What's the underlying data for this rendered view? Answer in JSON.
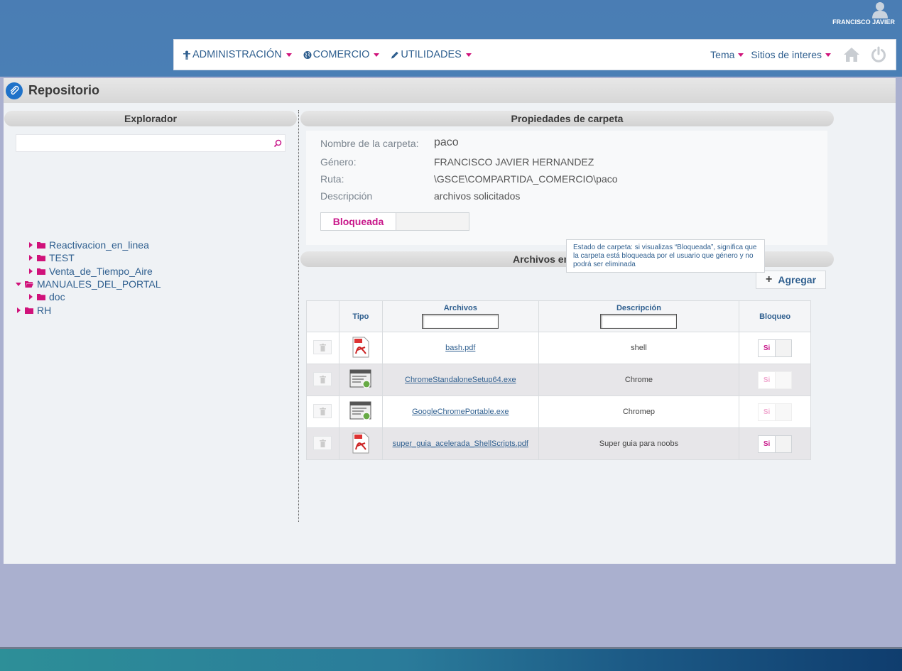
{
  "user": {
    "name": "FRANCISCO JAVIER"
  },
  "nav": {
    "menus": [
      {
        "label": "ADMINISTRACIÓN",
        "icon": "person-icon"
      },
      {
        "label": "COMERCIO",
        "icon": "globe-icon"
      },
      {
        "label": "UTILIDADES",
        "icon": "pencil-icon"
      }
    ],
    "right": [
      {
        "label": "Tema"
      },
      {
        "label": "Sitios de interes"
      }
    ]
  },
  "page": {
    "title": "Repositorio"
  },
  "explorer": {
    "header": "Explorador",
    "search_value": "",
    "tree": [
      {
        "label": "Reactivacion_en_linea",
        "level": 1,
        "expanded": false
      },
      {
        "label": "TEST",
        "level": 1,
        "expanded": false
      },
      {
        "label": "Venta_de_Tiempo_Aire",
        "level": 1,
        "expanded": false
      },
      {
        "label": "MANUALES_DEL_PORTAL",
        "level": 0,
        "expanded": true
      },
      {
        "label": "doc",
        "level": 1,
        "expanded": false
      },
      {
        "label": "RH",
        "level": 0,
        "expanded": false
      }
    ]
  },
  "properties": {
    "header": "Propiedades de carpeta",
    "name_label": "Nombre de la carpeta:",
    "name_value": "paco",
    "genre_label": "Género:",
    "genre_value": "FRANCISCO JAVIER HERNANDEZ",
    "path_label": "Ruta:",
    "path_value": "\\GSCE\\COMPARTIDA_COMERCIO\\paco",
    "desc_label": "Descripción",
    "desc_value": "archivos solicitados",
    "lock_label": "Bloqueada"
  },
  "tooltip": {
    "text": "Estado de carpeta: si visualizas “Bloqueada”, significa que la carpeta está bloqueada por el usuario que género y no podrá ser eliminada"
  },
  "files_section": {
    "header": "Archivos en",
    "add_label": "Agregar",
    "columns": {
      "tipo": "Tipo",
      "archivos": "Archivos",
      "descripcion": "Descripción",
      "bloqueo": "Bloqueo"
    },
    "filter_archivos": "",
    "filter_descripcion": "",
    "rows": [
      {
        "type": "pdf",
        "name": "bash.pdf",
        "description": "shell",
        "lock": "Si",
        "lock_enabled": true
      },
      {
        "type": "exe",
        "name": "ChromeStandaloneSetup64.exe",
        "description": "Chrome",
        "lock": "Si",
        "lock_enabled": false
      },
      {
        "type": "exe",
        "name": "GoogleChromePortable.exe",
        "description": "Chromep",
        "lock": "Si",
        "lock_enabled": false
      },
      {
        "type": "pdf",
        "name": "super_guia_acelerada_ShellScripts.pdf",
        "description": "Super guia para noobs",
        "lock": "Si",
        "lock_enabled": true
      }
    ]
  },
  "colors": {
    "accent": "#d0127a",
    "link": "#2f5f8f",
    "header": "#4a7db4"
  }
}
